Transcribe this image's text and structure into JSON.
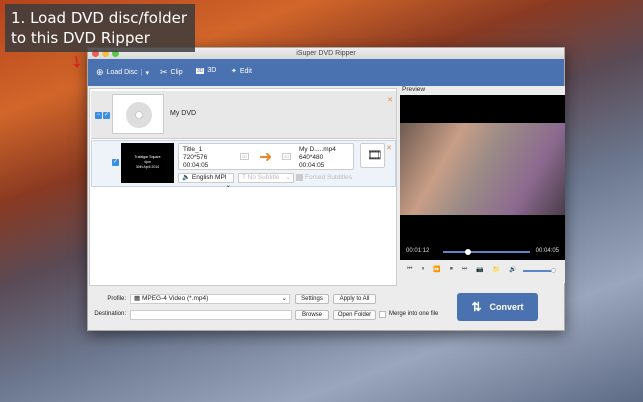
{
  "callout": {
    "text": "1. Load DVD disc/folder to this DVD Ripper"
  },
  "window": {
    "title": "iSuper DVD Ripper"
  },
  "toolbar": {
    "load_disc": "Load Disc",
    "clip": "Clip",
    "three_d": "3D",
    "three_d_icon_text": "3D",
    "edit": "Edit"
  },
  "disc": {
    "name": "My DVD"
  },
  "title_item": {
    "thumb_lines": [
      "Trafalgar Square",
      "4pm",
      "30th April 2010"
    ],
    "source_name": "Title_1",
    "source_res": "720*576",
    "source_duration": "00:04:05",
    "output_name": "My D.....mp4",
    "output_res": "640*480",
    "output_duration": "00:04:05",
    "audio": "English MPI",
    "subtitle": "No Subtitle",
    "forced_subtitles": "Forced Subtitles"
  },
  "preview": {
    "label": "Preview",
    "current_time": "00:01:12",
    "total_time": "00:04:05",
    "progress": 0.29,
    "volume": 0.9
  },
  "bottom": {
    "profile_label": "Profile:",
    "profile_value": "MPEG-4 Video (*.mp4)",
    "settings": "Settings",
    "apply_all": "Apply to All",
    "destination_label": "Destination:",
    "destination_value": "",
    "browse": "Browse",
    "open_folder": "Open Folder",
    "merge": "Merge into one file",
    "convert": "Convert"
  },
  "colors": {
    "accent": "#4a72b0",
    "arrow": "#e8882a"
  }
}
